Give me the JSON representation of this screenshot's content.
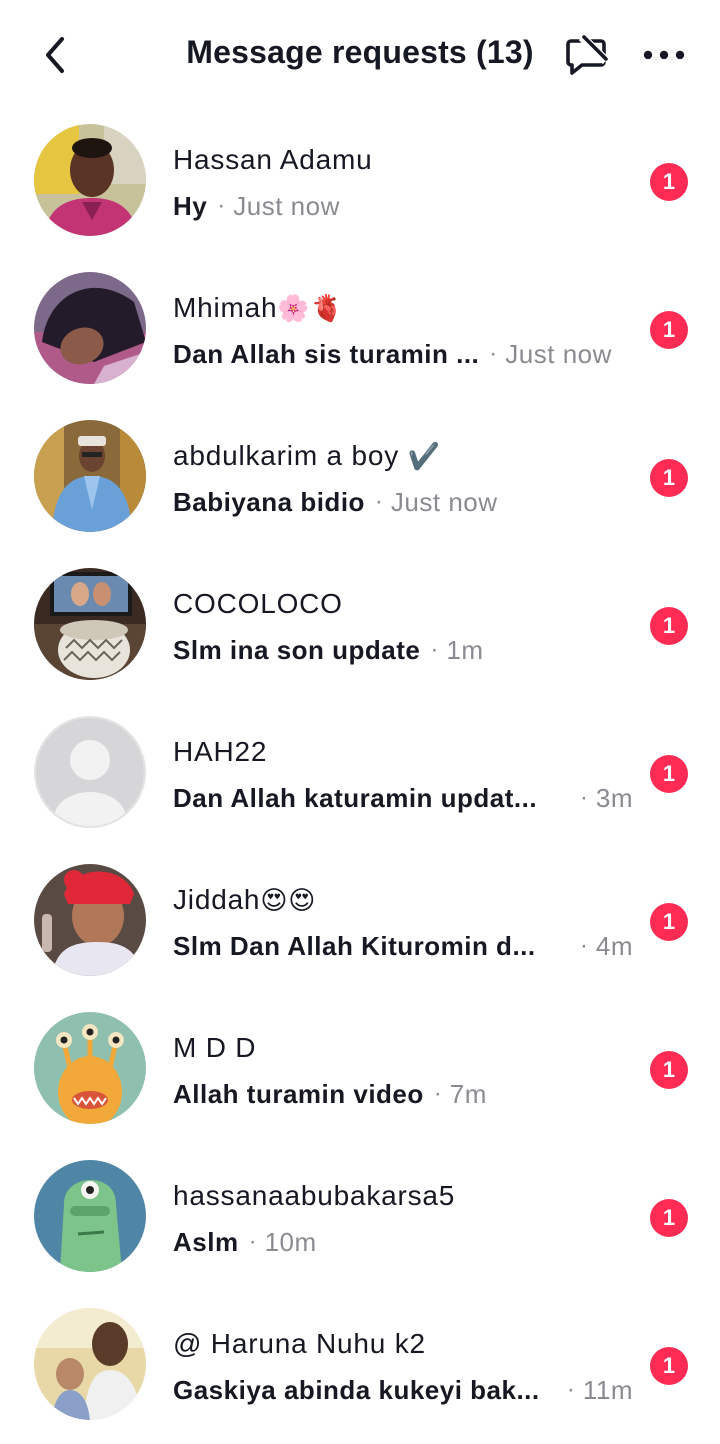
{
  "header": {
    "title": "Message requests (13)",
    "back_icon": "chevron-left-icon",
    "mute_icon": "chat-off-icon",
    "more_icon": "more-horizontal-icon"
  },
  "colors": {
    "badge": "#fe2c55",
    "secondary_text": "#8a8b91"
  },
  "requests": [
    {
      "name": "Hassan Adamu",
      "emoji": "",
      "message": "Hy",
      "time": "Just now",
      "badge": "1"
    },
    {
      "name": "Mhimah",
      "emoji": "🌸🫀",
      "message": "Dan Allah sis turamin ...",
      "time": "Just now",
      "badge": "1"
    },
    {
      "name": "abdulkarim a boy",
      "emoji": "✔️",
      "message": "Babiyana bidio",
      "time": "Just now",
      "badge": "1"
    },
    {
      "name": "COCOLOCO",
      "emoji": "",
      "message": "Slm ina son update",
      "time": "1m",
      "badge": "1"
    },
    {
      "name": "HAH22",
      "emoji": "",
      "message": "Dan Allah katuramin updat...",
      "time": "3m",
      "badge": "1"
    },
    {
      "name": "Jiddah",
      "emoji": "😍😍",
      "message": "Slm Dan Allah Kituromin d...",
      "time": "4m",
      "badge": "1"
    },
    {
      "name": "M D D",
      "emoji": "",
      "message": "Allah turamin video",
      "time": "7m",
      "badge": "1"
    },
    {
      "name": "hassanaabubakarsa5",
      "emoji": "",
      "message": "Aslm",
      "time": "10m",
      "badge": "1"
    },
    {
      "name": "@ Haruna Nuhu k2",
      "emoji": "",
      "message": "Gaskiya abinda kukeyi bak...",
      "time": "11m",
      "badge": "1"
    }
  ]
}
